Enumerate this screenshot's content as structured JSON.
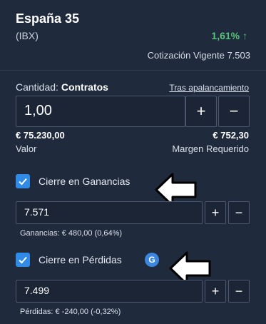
{
  "instrument": {
    "name": "España 35",
    "code": "(IBX)",
    "change": "1,61% ↑",
    "quote_label": "Cotización Vigente",
    "quote_value": "7.503"
  },
  "quantity": {
    "label": "Cantidad:",
    "unit": "Contratos",
    "leverage_link": "Tras apalancamiento",
    "value": "1,00",
    "plus": "+",
    "minus": "−",
    "value_amount": "€ 75.230,00",
    "value_label": "Valor",
    "margin_amount": "€ 752,30",
    "margin_label": "Margen Requerido"
  },
  "take_profit": {
    "label": "Cierre en Ganancias",
    "value": "7.571",
    "plus": "+",
    "minus": "−",
    "summary": "Ganancias:  € 480,00  (0,64%)"
  },
  "stop_loss": {
    "label": "Cierre en Pérdidas",
    "badge": "G",
    "value": "7.499",
    "plus": "+",
    "minus": "−",
    "summary": "Pérdidas:  € -240,00  (-0,32%)"
  },
  "colors": {
    "background": "#1f2a3c",
    "accent": "#2f8be6",
    "positive": "#57c278"
  },
  "icons": {
    "check": "check-icon",
    "pointer": "arrow-left-icon"
  }
}
